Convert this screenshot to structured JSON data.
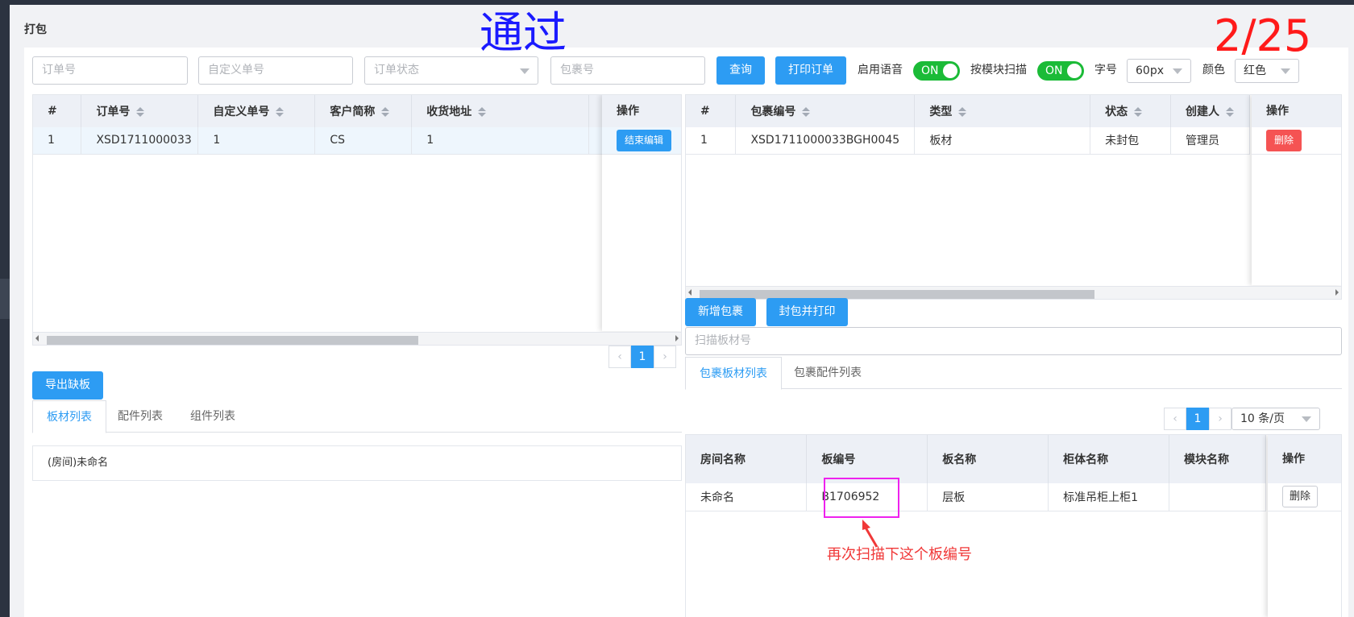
{
  "overlay": {
    "stamp": "通过",
    "counter": "2/25"
  },
  "page": {
    "title": "打包"
  },
  "toolbar": {
    "order_no_placeholder": "订单号",
    "custom_no_placeholder": "自定义单号",
    "order_status_placeholder": "订单状态",
    "package_no_placeholder": "包裹号",
    "query_label": "查询",
    "print_order_label": "打印订单",
    "voice_label": "启用语音",
    "voice_toggle": "ON",
    "module_scan_label": "按模块扫描",
    "module_scan_toggle": "ON",
    "font_size_label": "字号",
    "font_size_value": "60px",
    "color_label": "颜色",
    "color_value": "红色"
  },
  "orders_table": {
    "columns": [
      "#",
      "订单号",
      "自定义单号",
      "客户简称",
      "收货地址",
      "操作"
    ],
    "rows": [
      {
        "idx": "1",
        "order_no": "XSD1711000033",
        "custom_no": "1",
        "customer": "CS",
        "address": "1",
        "action": "结束编辑"
      }
    ],
    "pager": {
      "current": "1"
    }
  },
  "packages_table": {
    "columns": [
      "#",
      "包裹编号",
      "类型",
      "状态",
      "创建人",
      "操作"
    ],
    "rows": [
      {
        "idx": "1",
        "package_no": "XSD1711000033BGH0045",
        "type": "板材",
        "status": "未封包",
        "creator": "管理员",
        "action": "删除"
      }
    ]
  },
  "package_actions": {
    "add_label": "新增包裹",
    "seal_print_label": "封包并打印",
    "scan_placeholder": "扫描板材号"
  },
  "package_tabs": {
    "panels": "包裹板材列表",
    "accessories": "包裹配件列表"
  },
  "left_bottom": {
    "export_label": "导出缺板",
    "tabs": [
      "板材列表",
      "配件列表",
      "组件列表"
    ],
    "room_item": "(房间)未命名"
  },
  "panel_list": {
    "pager": {
      "current": "1",
      "page_size": "10 条/页"
    },
    "columns": [
      "房间名称",
      "板编号",
      "板名称",
      "柜体名称",
      "模块名称",
      "操作"
    ],
    "rows": [
      {
        "room": "未命名",
        "panel_no": "B1706952",
        "panel_name": "层板",
        "cabinet": "标准吊柜上柜1",
        "module": "",
        "action": "删除"
      }
    ]
  },
  "annotation": {
    "text": "再次扫描下这个板编号"
  },
  "colors": {
    "primary": "#2d9cf3",
    "toggle_on": "#1bbb37",
    "danger": "#f55353",
    "annot": "#ee22ee"
  }
}
